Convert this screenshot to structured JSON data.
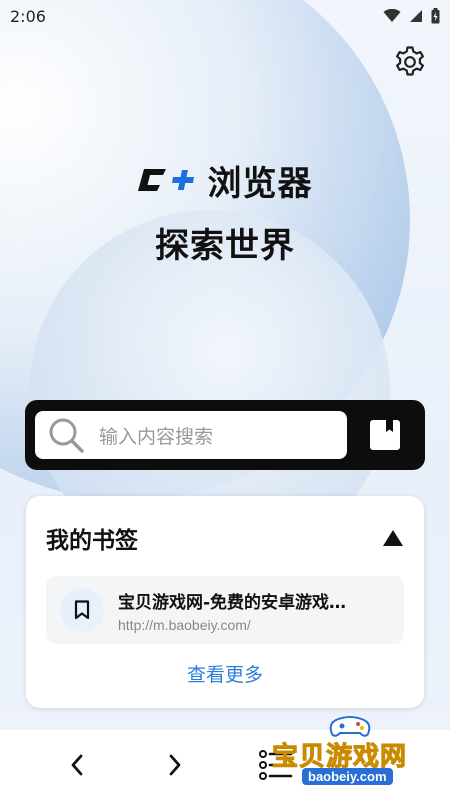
{
  "status_bar": {
    "time": "2:06"
  },
  "hero": {
    "logo_text": "C+",
    "app_name": "浏览器",
    "tagline": "探索世界"
  },
  "search": {
    "placeholder": "输入内容搜索"
  },
  "bookmarks": {
    "title": "我的书签",
    "items": [
      {
        "name": "宝贝游戏网-免费的安卓游戏…",
        "url": "http://m.baobeiy.com/"
      }
    ],
    "more_label": "查看更多"
  },
  "watermark": {
    "text": "宝贝游戏网",
    "url": "baobeiy.com"
  },
  "colors": {
    "accent": "#2b7fd9",
    "logo_plus": "#1d6fe0",
    "search_bg": "#0d0d0d"
  },
  "icons": [
    "wifi-icon",
    "signal-icon",
    "battery-icon",
    "gear-icon",
    "search-icon",
    "bookmark-icon",
    "chevron-up-icon",
    "back-icon",
    "forward-icon",
    "menu-icon"
  ]
}
